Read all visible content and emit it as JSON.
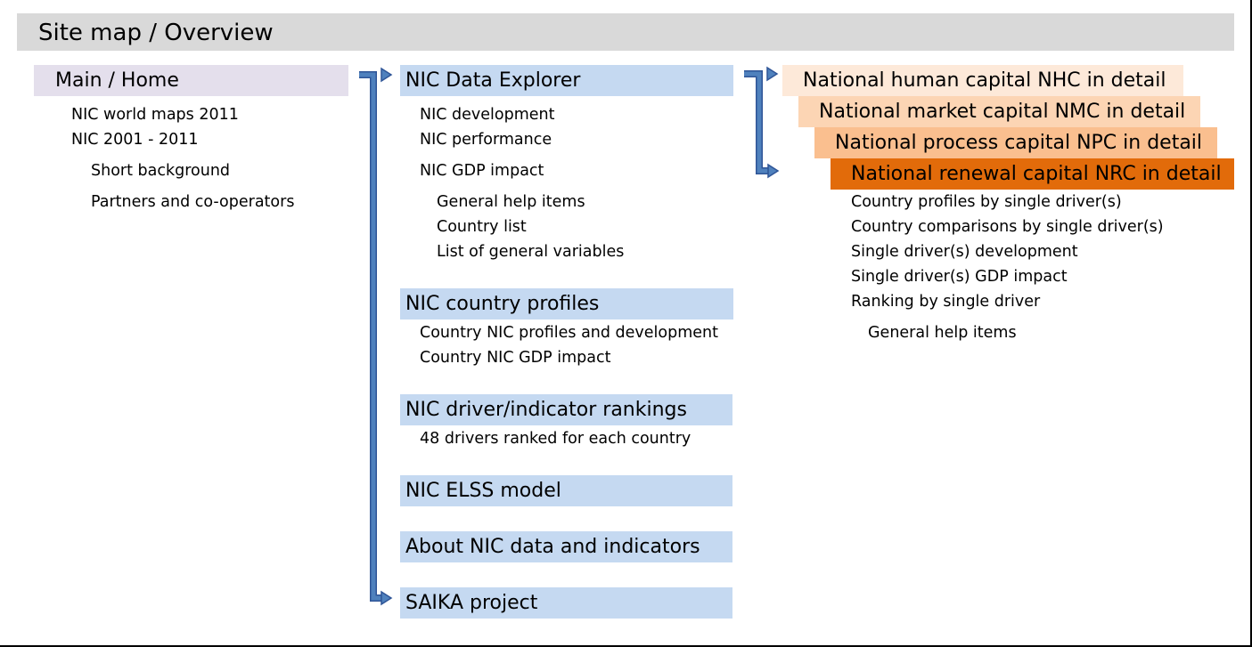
{
  "header": {
    "title": "Site map / Overview"
  },
  "home": {
    "title": "Main / Home",
    "items": [
      "NIC world maps 2011",
      "NIC 2001 - 2011"
    ],
    "subitems": [
      "Short background",
      "Partners and co-operators"
    ]
  },
  "sections": [
    {
      "title": "NIC Data Explorer",
      "items": [
        "NIC development",
        "NIC performance",
        "NIC GDP impact"
      ],
      "subitems": [
        "General help items",
        "Country list",
        "List of general variables"
      ]
    },
    {
      "title": "NIC country profiles",
      "items": [
        "Country NIC profiles and development",
        "Country NIC GDP impact"
      ]
    },
    {
      "title": "NIC driver/indicator rankings",
      "items": [
        "48 drivers ranked for each country"
      ]
    },
    {
      "title": "NIC ELSS model"
    },
    {
      "title": "About NIC data and indicators"
    },
    {
      "title": "SAIKA project"
    }
  ],
  "capitals": {
    "titles": [
      "National human capital NHC in detail",
      "National market capital NMC in detail",
      "National process capital NPC in detail",
      "National renewal capital NRC in detail"
    ],
    "items": [
      "Country profiles by single driver(s)",
      "Country comparisons by single driver(s)",
      "Single driver(s) development",
      "Single driver(s) GDP impact",
      "Ranking by single driver"
    ],
    "subitems": [
      "General help items"
    ]
  },
  "colors": {
    "header_bg": "#d9d9d9",
    "home_bg": "#e4dfec",
    "section_bg": "#c5d9f1",
    "arrow": "#4f81bd",
    "capital_shades": [
      "#fde9d9",
      "#fcd5b4",
      "#fabf8f",
      "#e26b0a"
    ]
  }
}
